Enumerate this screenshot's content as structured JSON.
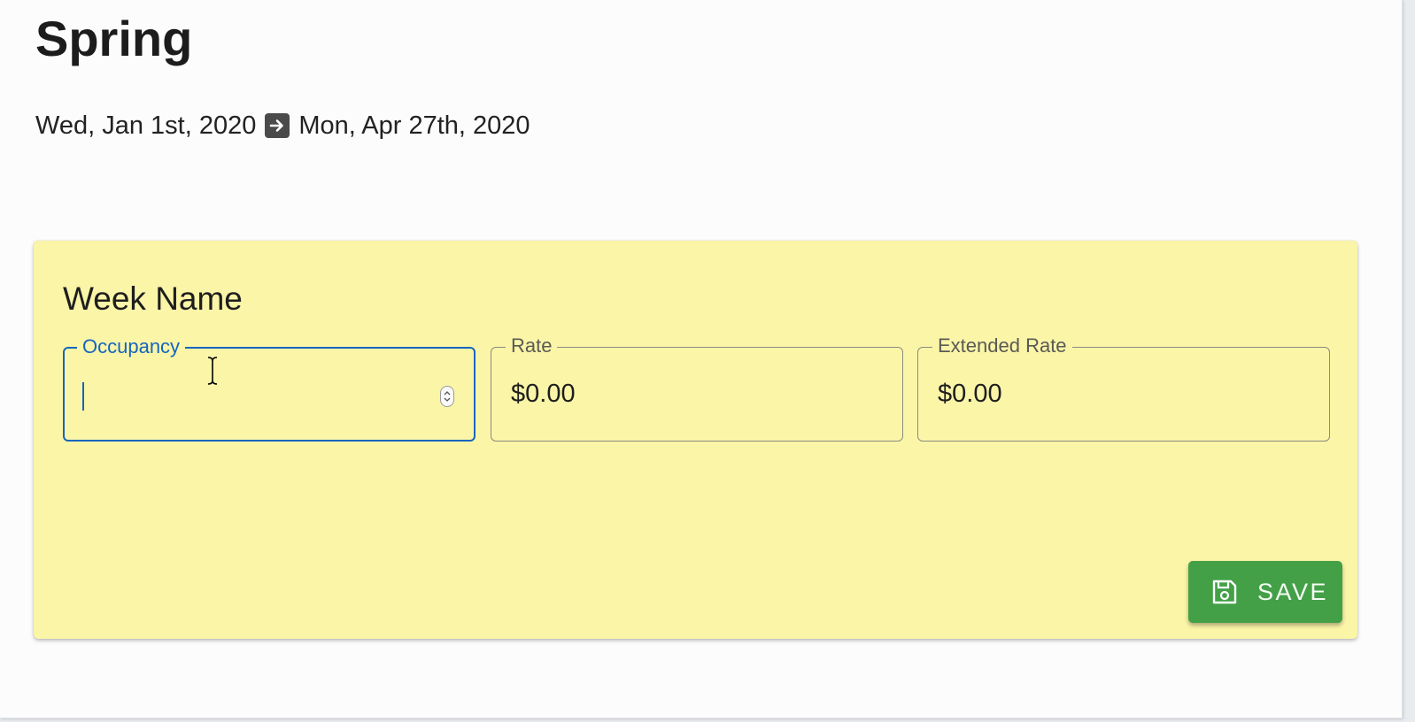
{
  "season": {
    "title": "Spring",
    "start_date": "Wed, Jan 1st, 2020",
    "end_date": "Mon, Apr 27th, 2020",
    "arrow_icon": "arrow-right-icon"
  },
  "card": {
    "title": "Week Name",
    "background": "#fbf5a8",
    "fields": [
      {
        "label": "Occupancy",
        "value": "",
        "focused": true
      },
      {
        "label": "Rate",
        "value": "$0.00",
        "focused": false
      },
      {
        "label": "Extended Rate",
        "value": "$0.00",
        "focused": false
      }
    ],
    "save": {
      "label": "SAVE",
      "icon": "save-icon",
      "color": "#43a047"
    }
  },
  "colors": {
    "focus": "#1565c0"
  }
}
